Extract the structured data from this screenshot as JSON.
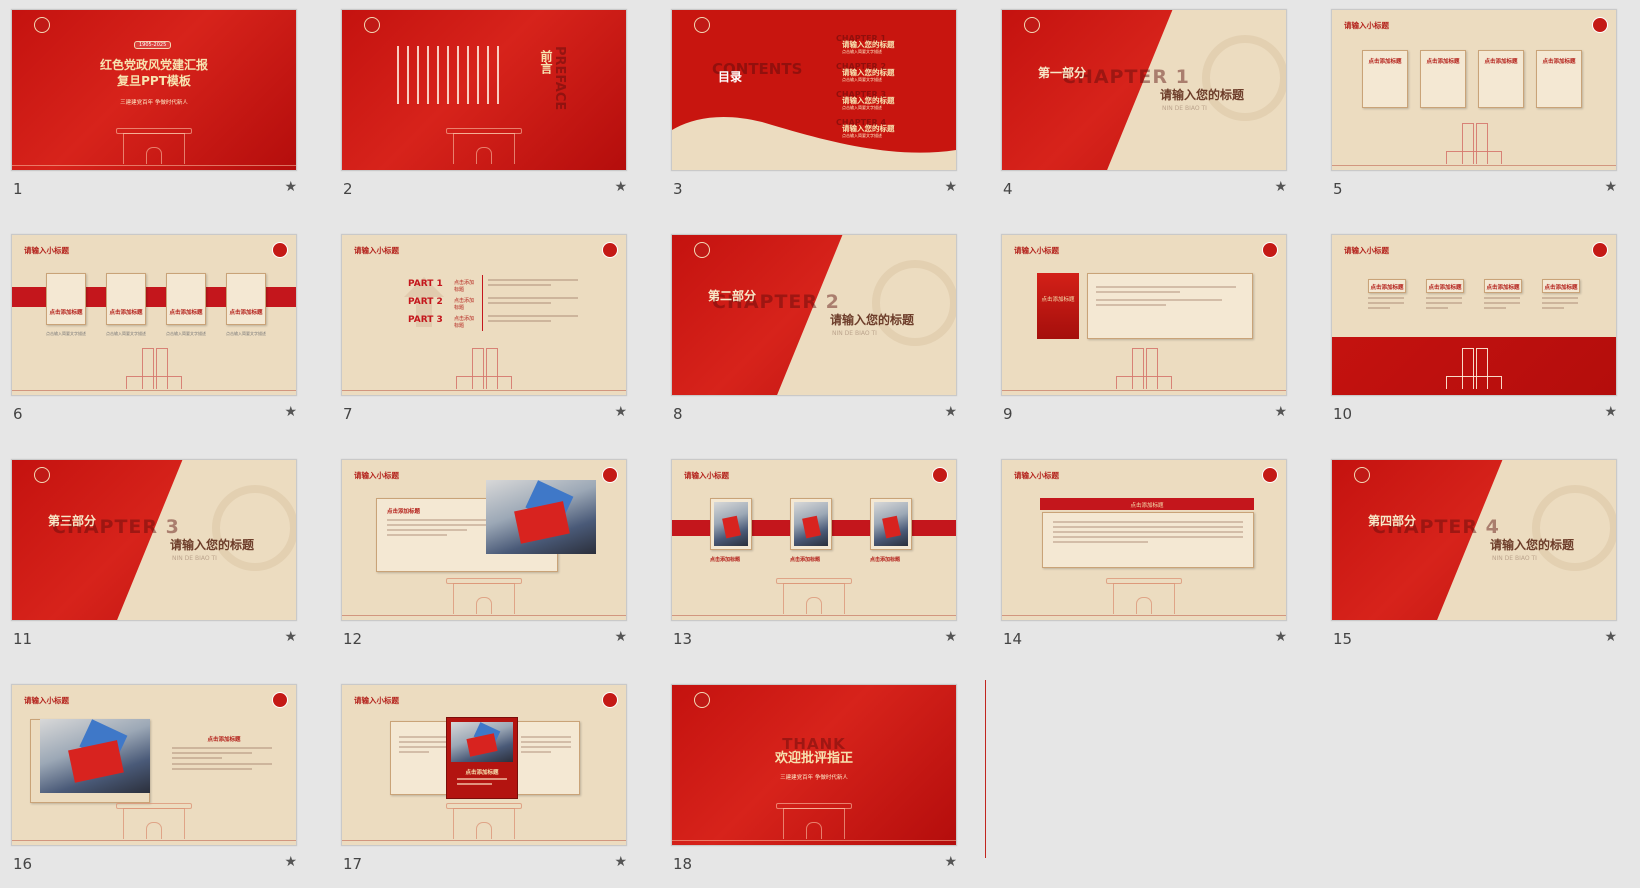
{
  "app": {
    "view": "slide-sorter"
  },
  "slides": [
    {
      "number": "1",
      "title_line1": "红色党政风党建汇报",
      "title_line2": "复旦PPT模板",
      "date_badge": "1905-2025",
      "subtitle": "三建建党百年 争做时代新人"
    },
    {
      "number": "2",
      "title": "前言",
      "big_en": "PREFACE"
    },
    {
      "number": "3",
      "title": "目录",
      "big_en": "CONTENTS",
      "items": [
        "请输入您的标题",
        "请输入您的标题",
        "请输入您的标题",
        "请输入您的标题"
      ],
      "item_bg": [
        "CHAPTER 1",
        "CHAPTER 2",
        "CHAPTER 3",
        "CHAPTER 4"
      ],
      "item_sub": "点击输入简要文字描述"
    },
    {
      "number": "4",
      "label": "第一部分",
      "big_en": "CHAPTER 1",
      "title": "请输入您的标题",
      "sub": "NIN DE BIAO TI"
    },
    {
      "number": "5",
      "small_title": "请输入小标题",
      "card_title": "点击添加标题"
    },
    {
      "number": "6",
      "small_title": "请输入小标题",
      "card_title": "点击添加标题",
      "caption": "点击输入简要文字描述"
    },
    {
      "number": "7",
      "small_title": "请输入小标题",
      "parts": [
        "PART 1",
        "PART 2",
        "PART 3"
      ],
      "part_label": "点击添加标题"
    },
    {
      "number": "8",
      "label": "第二部分",
      "big_en": "CHAPTER 2",
      "title": "请输入您的标题",
      "sub": "NIN DE BIAO TI"
    },
    {
      "number": "9",
      "small_title": "请输入小标题",
      "red_box": "点击添加标题"
    },
    {
      "number": "10",
      "small_title": "请输入小标题",
      "card_title": "点击添加标题"
    },
    {
      "number": "11",
      "label": "第三部分",
      "big_en": "CHAPTER 3",
      "title": "请输入您的标题",
      "sub": "NIN DE BIAO TI"
    },
    {
      "number": "12",
      "small_title": "请输入小标题",
      "box_title": "点击添加标题"
    },
    {
      "number": "13",
      "small_title": "请输入小标题",
      "caption": "点击添加标题"
    },
    {
      "number": "14",
      "small_title": "请输入小标题",
      "banner": "点击添加标题"
    },
    {
      "number": "15",
      "label": "第四部分",
      "big_en": "CHAPTER 4",
      "title": "请输入您的标题",
      "sub": "NIN DE BIAO TI"
    },
    {
      "number": "16",
      "small_title": "请输入小标题",
      "right_title": "点击添加标题"
    },
    {
      "number": "17",
      "small_title": "请输入小标题",
      "center_title": "点击添加标题"
    },
    {
      "number": "18",
      "title": "欢迎批评指正",
      "big_en": "THANK",
      "subtitle": "三建建党百年 争做时代新人"
    }
  ],
  "star_glyph": "★",
  "colors": {
    "red": "#c4120f",
    "beige": "#ecdcc0",
    "gold": "#f7e3b0"
  }
}
